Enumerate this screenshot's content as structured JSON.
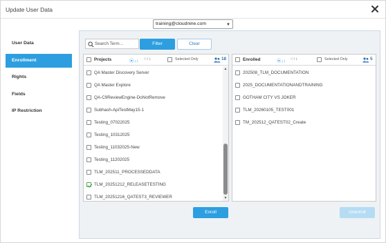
{
  "dialog": {
    "title": "Update User Data",
    "close_icon": "close-icon"
  },
  "user_select": {
    "value": "training@cloudnine.com"
  },
  "nav": {
    "items": [
      {
        "label": "User Data",
        "active": false
      },
      {
        "label": "Enrollment",
        "active": true
      },
      {
        "label": "Rights",
        "active": false
      },
      {
        "label": "Fields",
        "active": false
      },
      {
        "label": "IP Restriction",
        "active": false
      }
    ]
  },
  "search": {
    "placeholder": "Search Term...",
    "filter_label": "Filter",
    "clear_label": "Clear"
  },
  "projects": {
    "header_label": "Projects",
    "sort_a": "⦿↓↕",
    "sort_b": "○↑↕",
    "selected_only_label": "Selected Only",
    "count": "18",
    "items": [
      {
        "label": "QA Master Discovery Server",
        "checked": false
      },
      {
        "label": "QA Master Explore",
        "checked": false
      },
      {
        "label": "QA-C9ReviewEngine-DoNotRemove",
        "checked": false
      },
      {
        "label": "Subhash-ApiTestMay15-1",
        "checked": false
      },
      {
        "label": "Testing_07022025",
        "checked": false
      },
      {
        "label": "Testing_10312025",
        "checked": false
      },
      {
        "label": "Testing_11032025-New",
        "checked": false
      },
      {
        "label": "Testing_11202025",
        "checked": false
      },
      {
        "label": "TLM_202511_PROCESSEDDATA",
        "checked": false
      },
      {
        "label": "TLM_20251212_RELEASETESTING",
        "checked": true
      },
      {
        "label": "TLM_20251216_QATEST3_REVIEWER",
        "checked": false
      }
    ]
  },
  "enrolled": {
    "header_label": "Enrolled",
    "sort_a": "⦿↓↕",
    "sort_b": "○↑↕",
    "selected_only_label": "Selected Only",
    "count": "5",
    "items": [
      {
        "label": "202508_TLM_DOCUMENTATION",
        "checked": false
      },
      {
        "label": "2025_DOCUMENTATIONANDTRAINING",
        "checked": false
      },
      {
        "label": "GOTHAM CITY VS JOKER",
        "checked": false
      },
      {
        "label": "TLM_20260105_TEST001",
        "checked": false
      },
      {
        "label": "TM_202512_QATEST02_Create",
        "checked": false
      }
    ]
  },
  "actions": {
    "enroll_label": "Enroll",
    "unenroll_label": "Unenroll"
  },
  "colors": {
    "accent": "#2d9ee0",
    "disabled_button": "#b6dcf3",
    "panel_bg": "#eef2f5"
  }
}
